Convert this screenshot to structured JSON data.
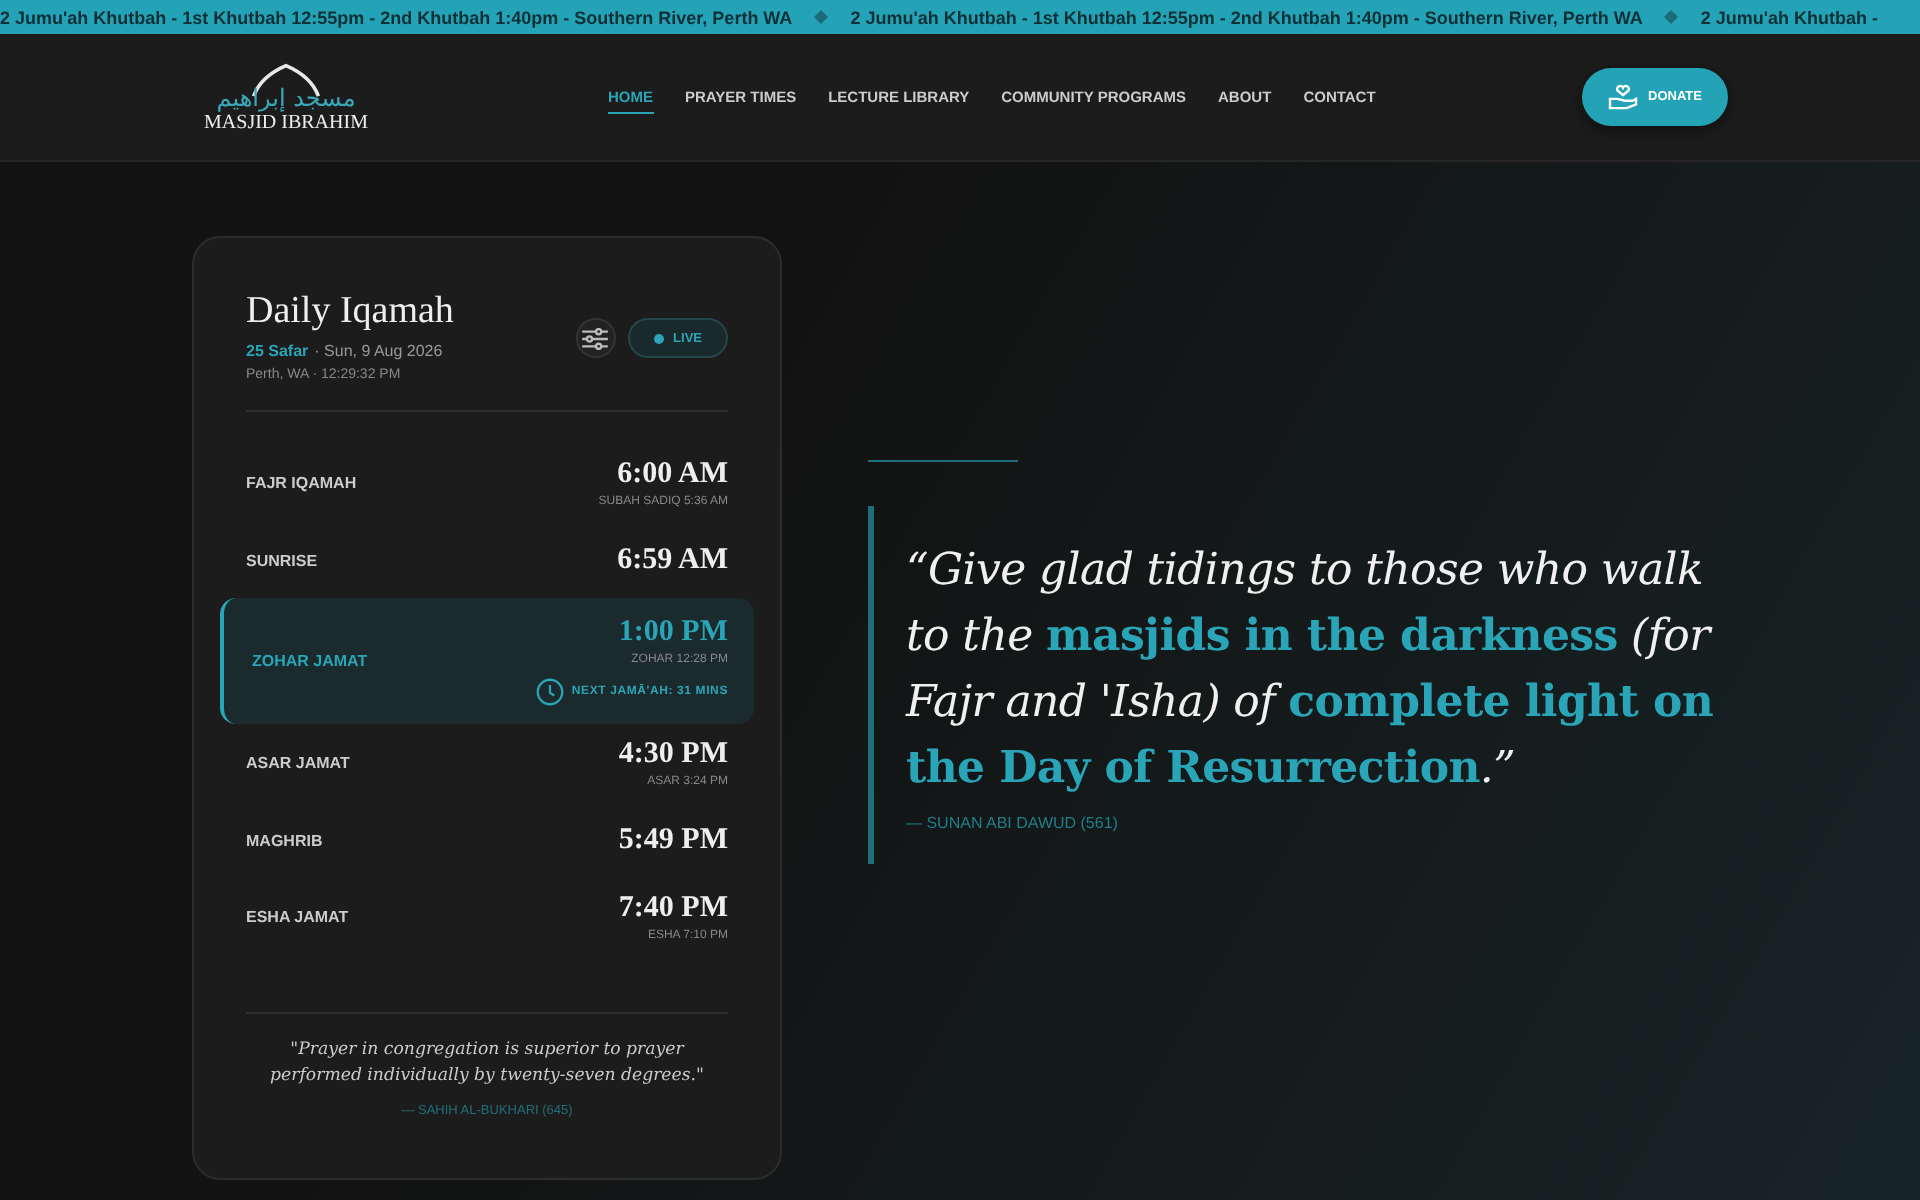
{
  "ticker": [
    "2 Jumu'ah Khutbah - 1st Khutbah 12:55pm - 2nd Khutbah 1:40pm - Southern River, Perth WA",
    "2 Jumu'ah Khutbah - 1st Khutbah 12:55pm - 2nd Khutbah 1:40pm - Southern River, Perth WA",
    "2 Jumu'ah Khutbah -"
  ],
  "logo": {
    "arabic": "مسجد إبراهيم",
    "name": "MASJID IBRAHIM"
  },
  "nav": [
    {
      "label": "HOME",
      "selected": true
    },
    {
      "label": "PRAYER TIMES",
      "selected": false
    },
    {
      "label": "LECTURE LIBRARY",
      "selected": false
    },
    {
      "label": "COMMUNITY PROGRAMS",
      "selected": false
    },
    {
      "label": "ABOUT",
      "selected": false
    },
    {
      "label": "CONTACT",
      "selected": false
    }
  ],
  "donate_button": "DONATE",
  "card": {
    "title": "Daily Iqamah",
    "hijri_date": "25 Safar",
    "date": "· Sun, 9 Aug 2026",
    "location": "Perth, WA · 12:29:32 PM",
    "live_badge": "LIVE",
    "prayers": [
      {
        "name": "FAJR IQAMAH",
        "time": "6:00 AM",
        "sub": "SUBAH SADIQ 5:36 AM",
        "selected": false
      },
      {
        "name": "SUNRISE",
        "time": "6:59 AM",
        "selected": false
      },
      {
        "name": "ZOHAR JAMAT",
        "time": "1:00 PM",
        "sub": "ZOHAR 12:28 PM",
        "next": "NEXT JAMĀ'AH: 31 MINS",
        "selected": true
      },
      {
        "name": "ASAR JAMAT",
        "time": "4:30 PM",
        "sub": "ASAR 3:24 PM",
        "selected": false
      },
      {
        "name": "MAGHRIB",
        "time": "5:49 PM",
        "selected": false
      },
      {
        "name": "ESHA JAMAT",
        "time": "7:40 PM",
        "sub": "ESHA 7:10 PM",
        "selected": false
      }
    ],
    "quote": "\"Prayer in congregation is superior to prayer performed individually by twenty-seven degrees.\"",
    "source": "— SAHIH AL-BUKHARI (645)"
  },
  "hero": {
    "quote": "“Give glad tidings to those who walk to the **masjids in the darkness** (for Fajr and 'Isha) of **complete light on the Day of Resurrection**.”",
    "source": "— SUNAN ABI DAWUD (561)"
  }
}
